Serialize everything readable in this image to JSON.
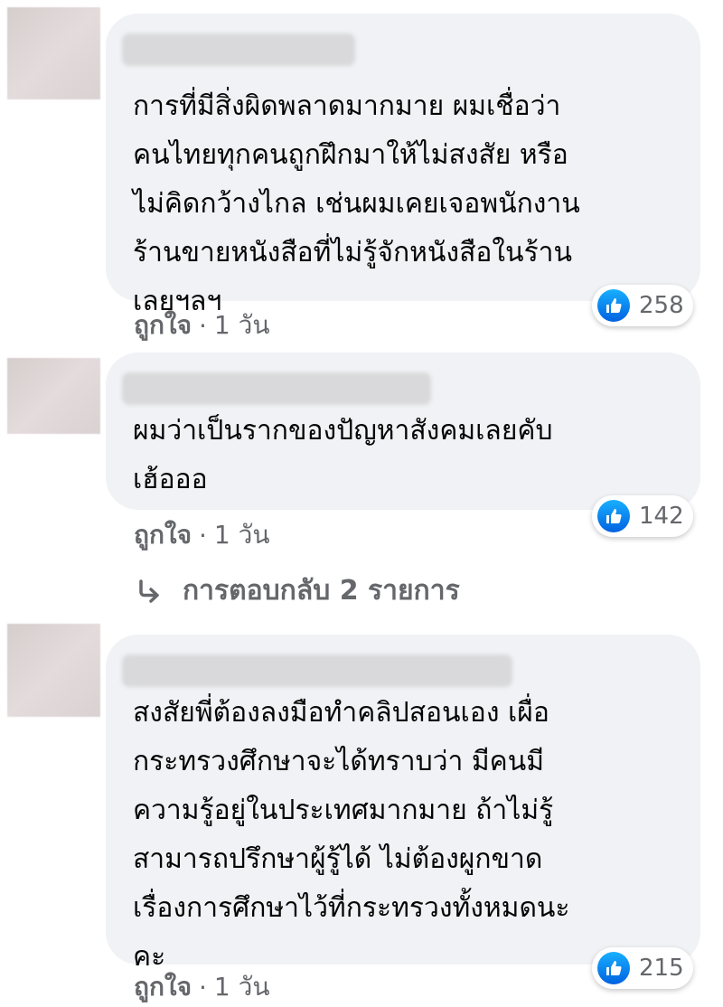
{
  "comments": [
    {
      "text": "การที่มีสิ่งผิดพลาดมากมาย ผมเชื่อว่า\nคนไทยทุกคนถูกฝึกมาให้ไม่สงสัย หรือ\nไม่คิดกว้างไกล เช่นผมเคยเจอพนักงาน\nร้านขายหนังสือที่ไม่รู้จักหนังสือในร้าน\nเลยฯลฯ",
      "reaction_count": "258",
      "like_label": "ถูกใจ",
      "separator": "·",
      "time": "1 วัน"
    },
    {
      "text": "ผมว่าเป็นรากของปัญหาสังคมเลยคับ\nเฮ้อออ",
      "reaction_count": "142",
      "like_label": "ถูกใจ",
      "separator": "·",
      "time": "1 วัน",
      "replies_label": "การตอบกลับ 2 รายการ"
    },
    {
      "text": "สงสัยพี่ต้องลงมือทำคลิปสอนเอง เผื่อ\nกระทรวงศึกษาจะได้ทราบว่า มีคนมี\nความรู้อยู่ในประเทศมากมาย ถ้าไม่รู้\nสามารถปรึกษาผู้รู้ได้ ไม่ต้องผูกขาด\nเรื่องการศึกษาไว้ที่กระทรวงทั้งหมดนะ\nคะ",
      "reaction_count": "215",
      "like_label": "ถูกใจ",
      "separator": "·",
      "time": "1 วัน"
    }
  ],
  "icons": {
    "reaction": "thumbs-up-icon",
    "reply": "reply-arrow-icon"
  },
  "colors": {
    "bubble": "#f0f2f5",
    "meta_text": "#65676b",
    "like_blue": "#1877f2"
  }
}
